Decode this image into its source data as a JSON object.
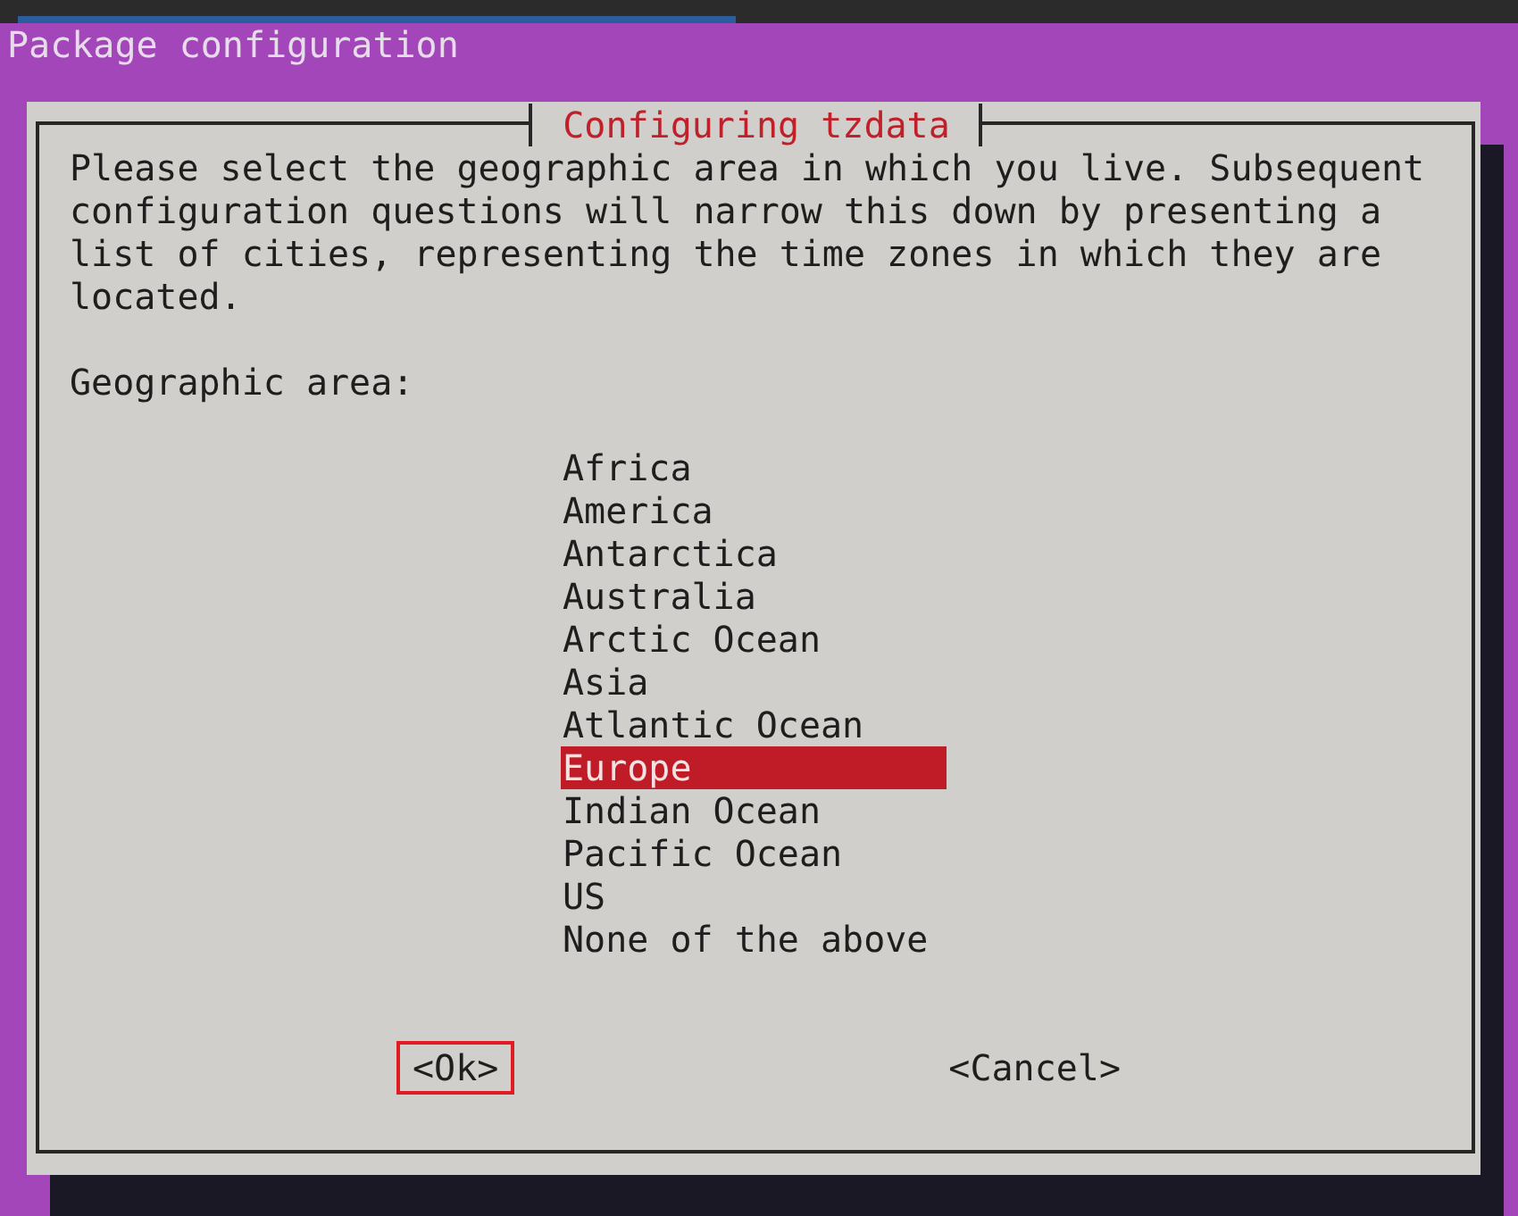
{
  "screen": {
    "title": "Package configuration"
  },
  "dialog": {
    "title": "Configuring tzdata",
    "message": "Please select the geographic area in which you live. Subsequent configuration questions will narrow this down by presenting a list of cities, representing the time zones in which they are located.",
    "prompt": "Geographic area:",
    "options": [
      {
        "label": "Africa",
        "selected": false
      },
      {
        "label": "America",
        "selected": false
      },
      {
        "label": "Antarctica",
        "selected": false
      },
      {
        "label": "Australia",
        "selected": false
      },
      {
        "label": "Arctic Ocean",
        "selected": false
      },
      {
        "label": "Asia",
        "selected": false
      },
      {
        "label": "Atlantic Ocean",
        "selected": false
      },
      {
        "label": "Europe",
        "selected": true
      },
      {
        "label": "Indian Ocean",
        "selected": false
      },
      {
        "label": "Pacific Ocean",
        "selected": false
      },
      {
        "label": "US",
        "selected": false
      },
      {
        "label": "None of the above",
        "selected": false
      }
    ],
    "buttons": [
      {
        "label": "<Ok>",
        "selected": true
      },
      {
        "label": "<Cancel>",
        "selected": false
      }
    ]
  }
}
